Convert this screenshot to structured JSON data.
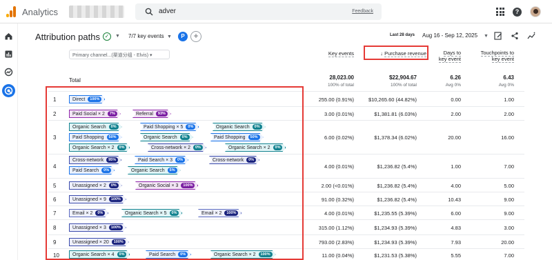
{
  "app": {
    "title": "Analytics",
    "search_query": "adver",
    "feedback": "Feedback"
  },
  "header": {
    "title": "Attribution paths",
    "key_events": "7/7 key events",
    "avatar_letter": "P",
    "plus": "+",
    "date_label": "Last 28 days",
    "date_range": "Aug 16 - Sep 12, 2025"
  },
  "table": {
    "dimension_selector": "Primary channel...(渠道分组 - Elvis)",
    "total_label": "Total",
    "columns": {
      "key_events": "Key events",
      "purchase_revenue": "Purchase revenue",
      "days_line1": "Days to",
      "days_line2": "key event",
      "tp_line1": "Touchpoints to",
      "tp_line2": "key event"
    },
    "totals": {
      "key_events": "28,023.00",
      "key_events_sub": "100% of total",
      "revenue": "$22,904.67",
      "revenue_sub": "100% of total",
      "days": "6.26",
      "days_sub": "Avg 0%",
      "tp": "6.43",
      "tp_sub": "Avg 0%"
    },
    "rows": [
      {
        "idx": "1",
        "key_events": "255.00 (0.91%)",
        "revenue": "$10,265.60 (44.82%)",
        "days": "0.00",
        "tp": "1.00",
        "chips": [
          {
            "label": "Direct",
            "pct": "100%"
          }
        ]
      },
      {
        "idx": "2",
        "key_events": "3.00 (0.01%)",
        "revenue": "$1,381.81 (6.03%)",
        "days": "2.00",
        "tp": "2.00",
        "chips": [
          {
            "label": "Paid Social × 2",
            "pct": "7%"
          },
          {
            "label": "Referral",
            "pct": "93%"
          }
        ]
      },
      {
        "idx": "3",
        "key_events": "6.00 (0.02%)",
        "revenue": "$1,378.34 (6.02%)",
        "days": "20.00",
        "tp": "16.00",
        "chips": [
          {
            "label": "Organic Search",
            "pct": "0%"
          },
          {
            "label": "Paid Shopping × 5",
            "pct": "0%"
          },
          {
            "label": "Organic Search",
            "pct": "0%"
          },
          {
            "label": "Paid Shopping",
            "pct": "50%"
          },
          {
            "label": "Organic Search",
            "pct": "0%"
          },
          {
            "label": "Paid Shopping",
            "pct": "50%"
          },
          {
            "label": "Organic Search × 2",
            "pct": "0%"
          },
          {
            "label": "Cross-network × 2",
            "pct": "0%"
          },
          {
            "label": "Organic Search × 2",
            "pct": "0%"
          }
        ]
      },
      {
        "idx": "4",
        "key_events": "4.00 (0.01%)",
        "revenue": "$1,236.82 (5.4%)",
        "days": "1.00",
        "tp": "7.00",
        "chips": [
          {
            "label": "Cross-network",
            "pct": "95%"
          },
          {
            "label": "Paid Search × 3",
            "pct": "0%"
          },
          {
            "label": "Cross-network",
            "pct": "0%"
          },
          {
            "label": "Paid Search",
            "pct": "0%"
          },
          {
            "label": "Organic Search",
            "pct": "5%"
          }
        ]
      },
      {
        "idx": "5",
        "key_events": "2.00 (<0.01%)",
        "revenue": "$1,236.82 (5.4%)",
        "days": "4.00",
        "tp": "5.00",
        "chips": [
          {
            "label": "Unassigned × 2",
            "pct": "0%"
          },
          {
            "label": "Organic Social × 3",
            "pct": "100%"
          }
        ]
      },
      {
        "idx": "6",
        "key_events": "91.00 (0.32%)",
        "revenue": "$1,236.82 (5.4%)",
        "days": "10.43",
        "tp": "9.00",
        "chips": [
          {
            "label": "Unassigned × 9",
            "pct": "100%"
          }
        ]
      },
      {
        "idx": "7",
        "key_events": "4.00 (0.01%)",
        "revenue": "$1,235.55 (5.39%)",
        "days": "6.00",
        "tp": "9.00",
        "chips": [
          {
            "label": "Email × 2",
            "pct": "0%"
          },
          {
            "label": "Organic Search × 5",
            "pct": "0%"
          },
          {
            "label": "Email × 2",
            "pct": "100%"
          }
        ]
      },
      {
        "idx": "8",
        "key_events": "315.00 (1.12%)",
        "revenue": "$1,234.93 (5.39%)",
        "days": "4.83",
        "tp": "3.00",
        "chips": [
          {
            "label": "Unassigned × 3",
            "pct": "100%"
          }
        ]
      },
      {
        "idx": "9",
        "key_events": "793.00 (2.83%)",
        "revenue": "$1,234.93 (5.39%)",
        "days": "7.93",
        "tp": "20.00",
        "chips": [
          {
            "label": "Unassigned × 20",
            "pct": "100%"
          }
        ]
      },
      {
        "idx": "10",
        "key_events": "11.00 (0.04%)",
        "revenue": "$1,231.53 (5.38%)",
        "days": "5.55",
        "tp": "7.00",
        "chips": [
          {
            "label": "Organic Search × 4",
            "pct": "0%"
          },
          {
            "label": "Paid Search",
            "pct": "0%"
          },
          {
            "label": "Organic Search × 2",
            "pct": "100%"
          }
        ]
      }
    ]
  }
}
